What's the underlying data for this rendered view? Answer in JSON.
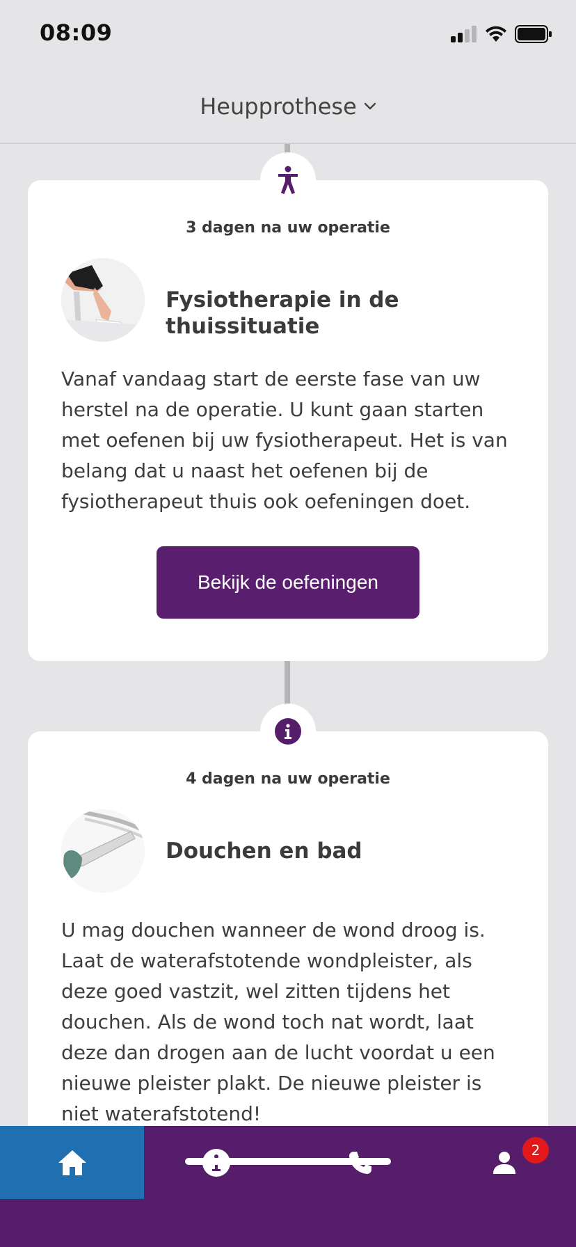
{
  "status": {
    "time": "08:09"
  },
  "header": {
    "title": "Heupprothese"
  },
  "timeline": [
    {
      "badge_icon": "accessibility-figure-icon",
      "day_label": "3 dagen na uw operatie",
      "thumb_icon": "physiotherapy-leg-photo",
      "title": "Fysiotherapie in de thuissituatie",
      "body": "Vanaf vandaag start de eerste fase van uw herstel na de operatie. U kunt gaan starten met oefenen bij uw fysiotherapeut. Het is van belang dat u naast het oefenen bij de fysiotherapeut thuis ook oefeningen doet.",
      "button_label": "Bekijk de oefeningen"
    },
    {
      "badge_icon": "info-icon",
      "day_label": "4 dagen na uw operatie",
      "thumb_icon": "shower-head-photo",
      "title": "Douchen en bad",
      "body": "U mag douchen wanneer de wond droog is. Laat de waterafstotende wondpleister, als deze goed vastzit, wel zitten tijdens het douchen. Als de wond toch nat wordt, laat deze dan drogen aan de lucht voordat u een nieuwe pleister plakt. De nieuwe pleister is niet waterafstotend!"
    }
  ],
  "tabbar": {
    "tabs": [
      {
        "icon": "home-icon",
        "active": true
      },
      {
        "icon": "info-icon",
        "active": false
      },
      {
        "icon": "phone-icon",
        "active": false
      },
      {
        "icon": "person-icon",
        "active": false,
        "badge": "2"
      }
    ]
  },
  "colors": {
    "primary": "#561d6b",
    "active_tab": "#1f6fb1",
    "badge": "#e2191b"
  }
}
